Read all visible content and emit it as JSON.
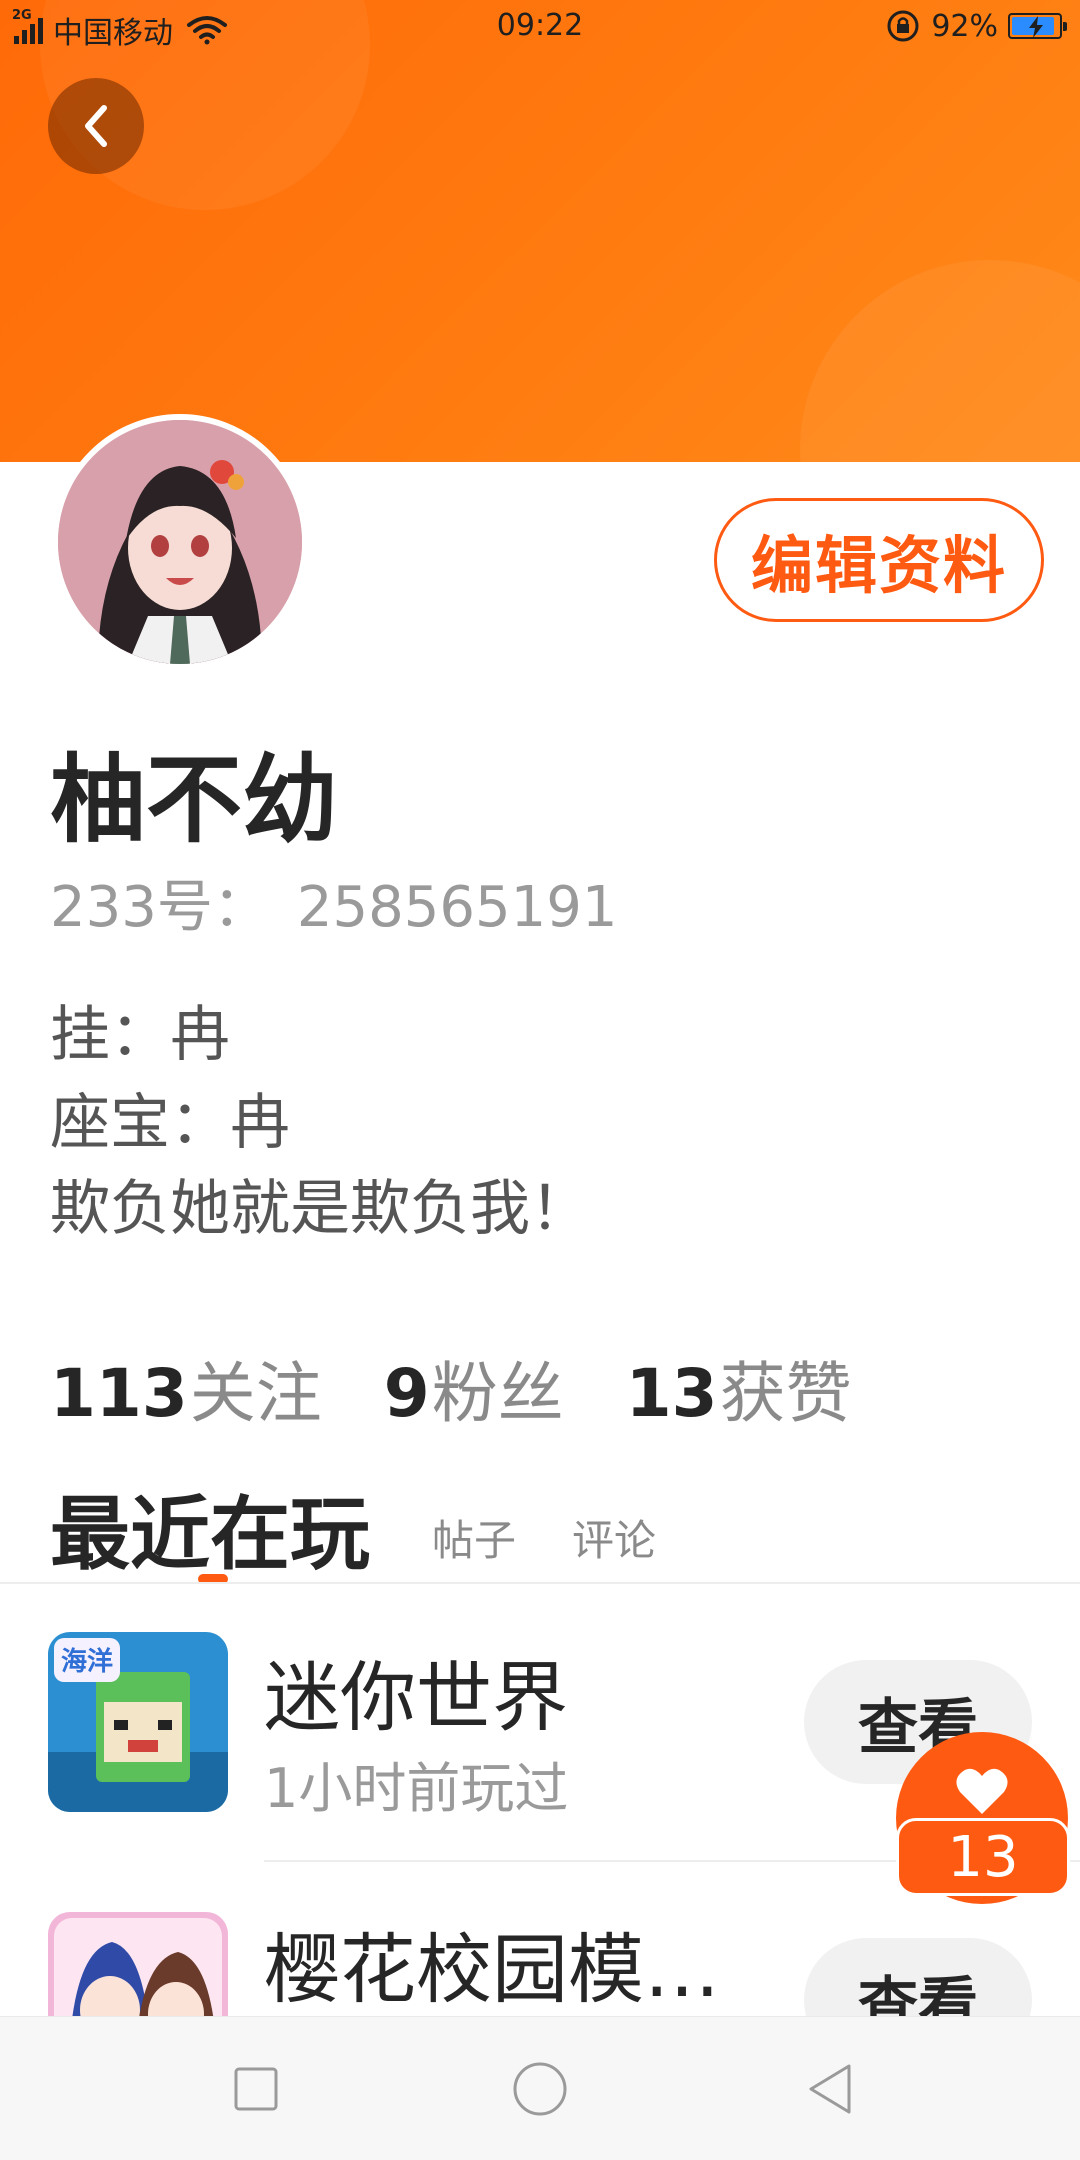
{
  "status_bar": {
    "network": "2G",
    "carrier": "中国移动",
    "time": "09:22",
    "battery": "92%",
    "battery_level": 0.92
  },
  "header": {
    "back_icon": "chevron-left-icon",
    "edit_button": "编辑资料"
  },
  "profile": {
    "name": "柚不幼",
    "id_label": "233号：",
    "id_value": "258565191",
    "bio": [
      "挂：冉",
      "座宝：冉",
      "欺负她就是欺负我！"
    ]
  },
  "stats": [
    {
      "value": "113",
      "label": "关注"
    },
    {
      "value": "9",
      "label": "粉丝"
    },
    {
      "value": "13",
      "label": "获赞"
    }
  ],
  "tabs": {
    "active": "最近在玩",
    "items": [
      "帖子",
      "评论"
    ]
  },
  "games": [
    {
      "title": "迷你世界",
      "time": "1小时前玩过",
      "button": "查看",
      "icon_text": "海洋"
    },
    {
      "title": "樱花校园模…",
      "time": "",
      "button": "查看"
    }
  ],
  "like": {
    "icon": "heart-icon",
    "count": "13"
  },
  "nav_bar": [
    "square-icon",
    "circle-icon",
    "triangle-back-icon"
  ],
  "colors": {
    "accent": "#ff5a12",
    "header": "#ff7412"
  }
}
